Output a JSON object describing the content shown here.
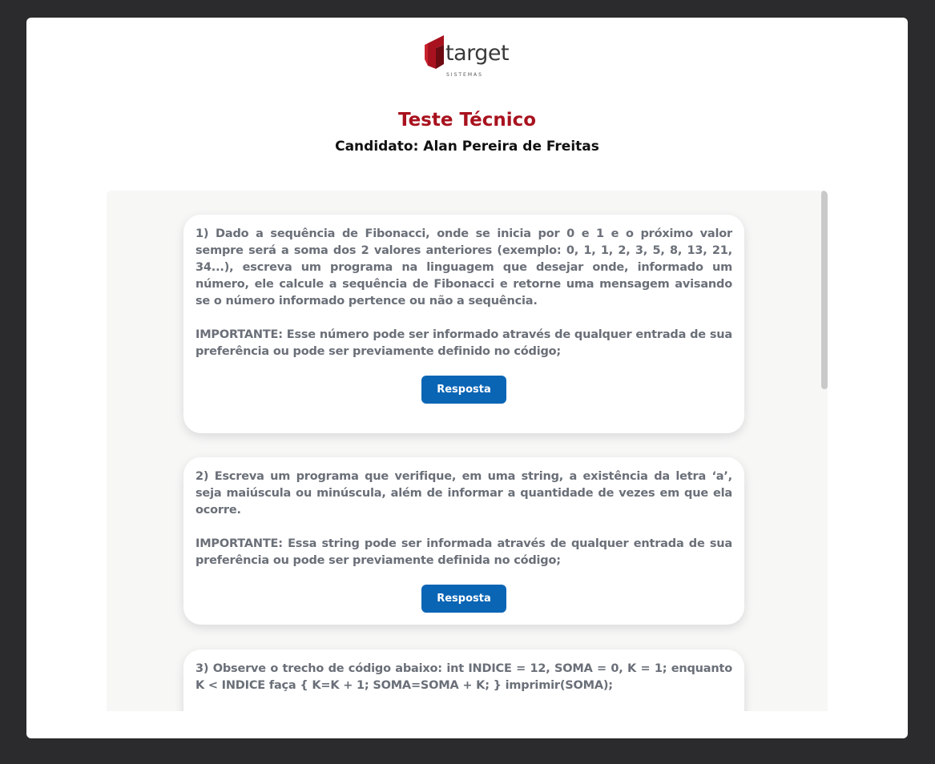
{
  "brand": {
    "logo_word": "target",
    "logo_sub": "SISTEMAS",
    "logo_color": "#a8121e"
  },
  "header": {
    "title": "Teste Técnico",
    "candidate": "Candidato: Alan Pereira de Freitas"
  },
  "colors": {
    "accent": "#a8121e",
    "button": "#0a65b5",
    "page_bg": "#2b2b2d",
    "content_bg": "#f7f7f6"
  },
  "questions": [
    {
      "text": "1) Dado a sequência de Fibonacci, onde se inicia por 0 e 1 e o próximo valor sempre será a soma dos 2 valores anteriores (exemplo: 0, 1, 1, 2, 3, 5, 8, 13, 21, 34...), escreva um programa na linguagem que desejar onde, informado um número, ele calcule a sequência de Fibonacci e retorne uma mensagem avisando se o número informado pertence ou não a sequência.",
      "note": "IMPORTANTE: Esse número pode ser informado através de qualquer entrada de sua preferência ou pode ser previamente definido no código;",
      "button": "Resposta"
    },
    {
      "text": "2) Escreva um programa que verifique, em uma string, a existência da letra ‘a’, seja maiúscula ou minúscula, além de informar a quantidade de vezes em que ela ocorre.",
      "note": "IMPORTANTE: Essa string pode ser informada através de qualquer entrada de sua preferência ou pode ser previamente definida no código;",
      "button": "Resposta"
    },
    {
      "text": "3) Observe o trecho de código abaixo: int INDICE = 12, SOMA = 0, K = 1; enquanto K < INDICE faça { K=K + 1; SOMA=SOMA + K; } imprimir(SOMA);"
    }
  ]
}
